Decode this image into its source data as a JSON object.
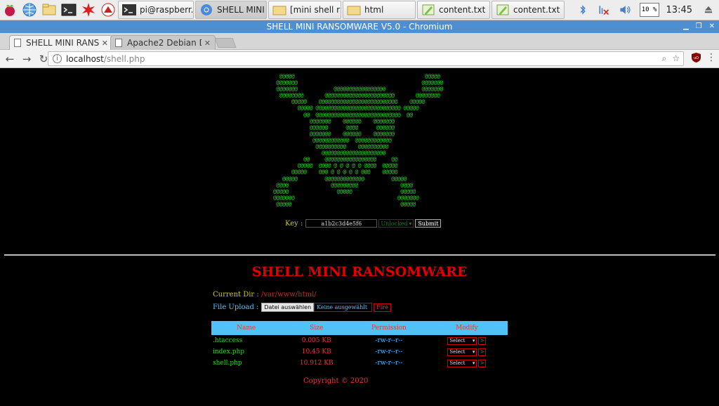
{
  "taskbar": {
    "tasks": [
      {
        "label": "pi@raspberr...",
        "icon": "terminal-icon"
      },
      {
        "label": "SHELL MINI ...",
        "icon": "chromium-icon",
        "active": true
      },
      {
        "label": "[mini shell ra...",
        "icon": "folder-icon"
      },
      {
        "label": "html",
        "icon": "folder-icon"
      },
      {
        "label": "content.txt",
        "icon": "text-editor-icon"
      },
      {
        "label": "content.txt",
        "icon": "text-editor-icon"
      }
    ],
    "cpu": "10 %",
    "clock": "13:45"
  },
  "window": {
    "title": "SHELL MINI RANSOMWARE V5.0 - Chromium"
  },
  "tabs": [
    {
      "label": "SHELL MINI RANSO",
      "active": true
    },
    {
      "label": "Apache2 Debian D",
      "active": false
    }
  ],
  "address": {
    "host": "localhost",
    "path": "/shell.php"
  },
  "art": "     @@@@@                                           @@@@@\n    @@@@@@@                                         @@@@@@@\n    @@@@@@@            @@@@@@@@@@@@@@@@@            @@@@@@@\n     @@@@@@@@       @@@@@@@@@@@@@@@@@@@@@@@       @@@@@@@@\n         @@@@@    @@@@@@@@@@@@@@@@@@@@@@@@@@    @@@@@\n           @@@@@ @@@@@@@@@@@@@@@@@@@@@@@@@@@@ @@@@@\n             @@  @@@@@@@@@@@@@@@@@@@@@@@@@@@@  @@\n               @@@@@@@    @@@@@@    @@@@@@@\n               @@@@@@      @@@@      @@@@@@\n               @@@@@@@    @@@@@@    @@@@@@@\n                @@@@@@@@@@@@  @@@@@@@@@@@@\n                 @@@@@@@@@@    @@@@@@@@@@\n                   @@@@@@@@@@@@@@@@@@@@@\n             @@     @@@@@@@@@@@@@@@@@     @@\n           @@@@@  @@@@ @ @ @ @ @ @@@@  @@@@@\n         @@@@@    @@@ @ @ @ @ @ @@@    @@@@@\n      @@@@@         @@@@@@@@@@@@@         @@@@@\n    @@@@              @@@@@@@@@              @@@@\n   @@@@@                @@@@@                @@@@@\n   @@@@@@@                                  @@@@@@@\n    @@@@@                                    @@@@@",
  "form": {
    "key_label": "Key :",
    "key_value": "a1b2c3d4e5f6",
    "status": "Unlocked",
    "submit": "Submit"
  },
  "heading": "SHELL MINI RANSOMWARE",
  "current_dir": {
    "label": "Current Dir :",
    "path": "/var/www/html/"
  },
  "upload": {
    "label": "File Upload :",
    "choose": "Datei auswählen",
    "none": "Keine ausgewählt",
    "fire": "Fire"
  },
  "table": {
    "headers": [
      "Name",
      "Size",
      "Permission",
      "Modify"
    ],
    "rows": [
      {
        "name": ".htaccess",
        "size": "0.005 KB",
        "perm": "-rw-r--r--",
        "select": "Select",
        "go": ">"
      },
      {
        "name": "index.php",
        "size": "10.45 KB",
        "perm": "-rw-r--r--",
        "select": "Select",
        "go": ">"
      },
      {
        "name": "shell.php",
        "size": "10.912 KB",
        "perm": "-rw-r--r--",
        "select": "Select",
        "go": ">"
      }
    ]
  },
  "copyright": "Copyright © 2020"
}
